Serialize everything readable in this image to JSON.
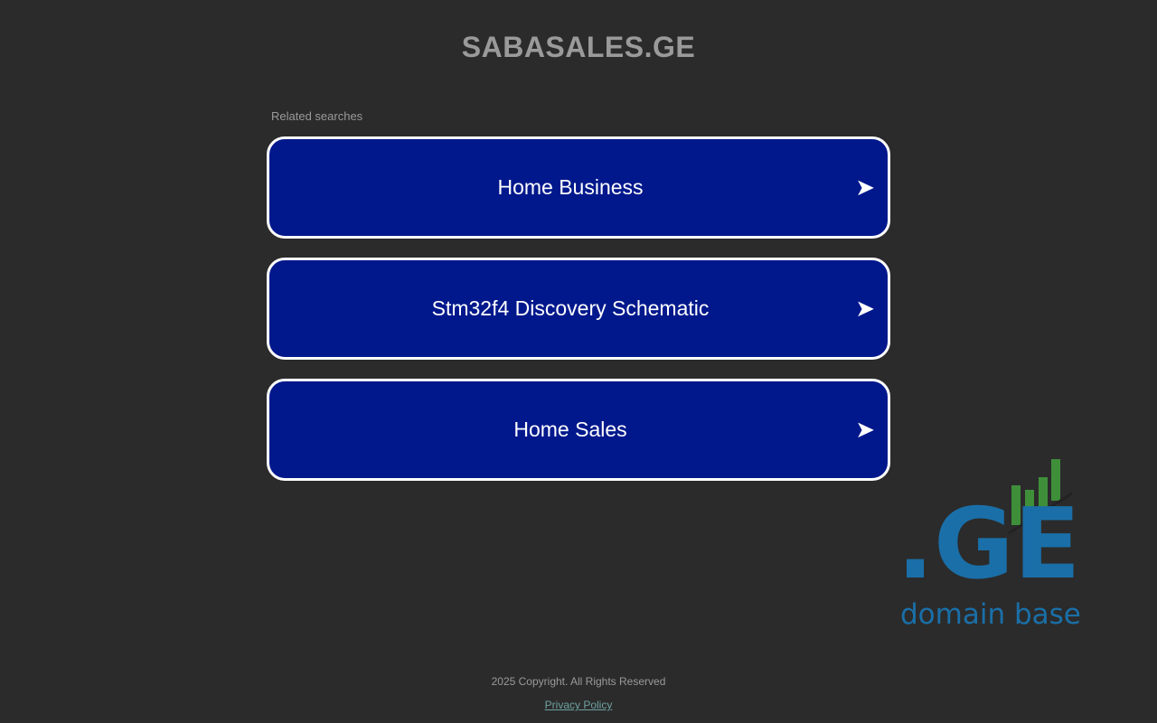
{
  "header": {
    "title": "SABASALES.GE"
  },
  "related": {
    "label": "Related searches",
    "items": [
      {
        "label": "Home Business",
        "arrow": "➤"
      },
      {
        "label": "Stm32f4 Discovery Schematic",
        "arrow": "➤"
      },
      {
        "label": "Home Sales",
        "arrow": "➤"
      }
    ]
  },
  "logo": {
    "mark": ".GE",
    "tagline": "domain base",
    "colors": {
      "blue": "#1a6fa8",
      "green": "#3f8f3a"
    }
  },
  "footer": {
    "copyright": "2025 Copyright. All Rights Reserved",
    "privacy_label": "Privacy Policy"
  },
  "colors": {
    "background": "#2b2b2b",
    "button_fill": "#00188c",
    "button_border": "#ffffff",
    "muted_text": "#9a9a9a",
    "link": "#6fa2a2"
  }
}
